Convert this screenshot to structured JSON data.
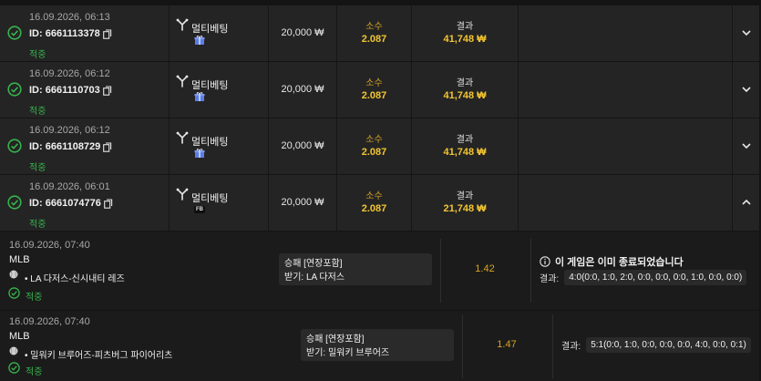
{
  "bets": [
    {
      "date": "16.09.2026, 06:13",
      "id": "ID: 6661113378",
      "status": "적중",
      "type": "멀티베팅",
      "badge": "gift-icon",
      "stake": "20,000 ₩",
      "odds_label": "소수",
      "odds": "2.087",
      "result_label": "결과",
      "result": "41,748 ₩",
      "expanded": false
    },
    {
      "date": "16.09.2026, 06:12",
      "id": "ID: 6661110703",
      "status": "적중",
      "type": "멀티베팅",
      "badge": "gift-icon",
      "stake": "20,000 ₩",
      "odds_label": "소수",
      "odds": "2.087",
      "result_label": "결과",
      "result": "41,748 ₩",
      "expanded": false
    },
    {
      "date": "16.09.2026, 06:12",
      "id": "ID: 6661108729",
      "status": "적중",
      "type": "멀티베팅",
      "badge": "gift-icon",
      "stake": "20,000 ₩",
      "odds_label": "소수",
      "odds": "2.087",
      "result_label": "결과",
      "result": "41,748 ₩",
      "expanded": false
    },
    {
      "date": "16.09.2026, 06:01",
      "id": "ID: 6661074776",
      "status": "적중",
      "type": "멀티베팅",
      "badge": "FB",
      "stake": "20,000 ₩",
      "odds_label": "소수",
      "odds": "2.087",
      "result_label": "결과",
      "result": "21,748 ₩",
      "expanded": true
    }
  ],
  "details": [
    {
      "date": "16.09.2026, 07:40",
      "league": "MLB",
      "match": "• LA 다저스-신시내티 레즈",
      "status": "적중",
      "market": "승패 [연장포함]",
      "pick": "받기: LA 다저스",
      "odds": "1.42",
      "notice": "이 게임은 이미 종료되었습니다",
      "score_label": "결과:",
      "score": "4:0(0:0, 1:0, 2:0, 0:0, 0:0, 0:0, 1:0, 0:0, 0:0)"
    },
    {
      "date": "16.09.2026, 07:40",
      "league": "MLB",
      "match": "• 밀워키 브루어즈-피츠버그 파이어리츠",
      "status": "적중",
      "market": "승패 [연장포함]",
      "pick": "받기: 밀워키 브루어즈",
      "odds": "1.47",
      "notice": "",
      "score_label": "결과:",
      "score": "5:1(0:0, 1:0, 0:0, 0:0, 0:0, 4:0, 0:0, 0:1)"
    }
  ],
  "colors": {
    "win": "#37b24d",
    "odds": "#f2c530",
    "row_bg": "#242424",
    "detail_bg": "#1b1b1b"
  }
}
